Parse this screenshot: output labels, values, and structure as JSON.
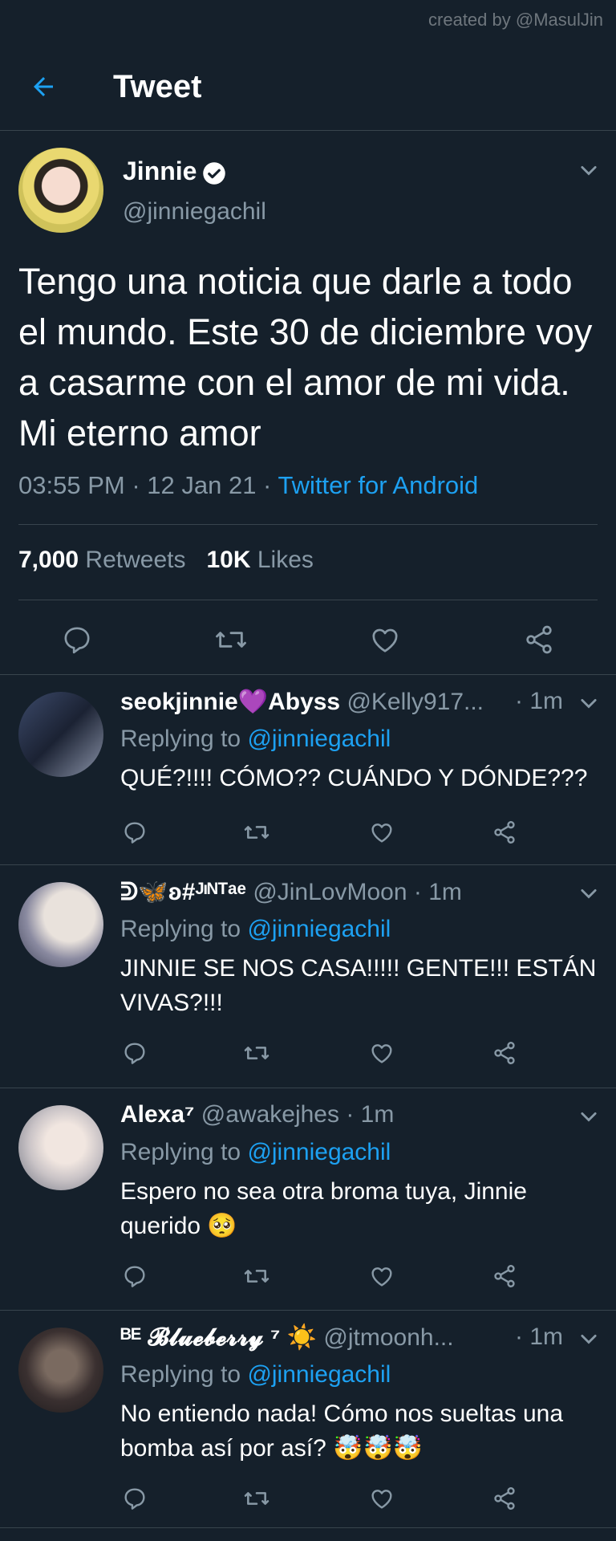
{
  "credit": "created by @MasulJin",
  "header": {
    "title": "Tweet",
    "back_icon": "arrow-left-icon"
  },
  "tweet": {
    "name": "Jinnie",
    "handle": "@jinniegachil",
    "text": "Tengo una noticia que darle a todo el mundo. Este 30 de diciembre voy a casarme con el amor de mi vida. Mi eterno amor",
    "time": "03:55 PM",
    "date": "12 Jan 21",
    "separator": " · ",
    "source": "Twitter for Android",
    "retweets_count": "7,000",
    "retweets_label": "Retweets",
    "likes_count": "10K",
    "likes_label": "Likes"
  },
  "replies": [
    {
      "name": "seokjinnie💜Abyss",
      "handle": "@Kelly917...",
      "time": "· 1m",
      "replying_prefix": "Replying to ",
      "replying_to": "@jinniegachil",
      "text": "QUÉ?!!!! CÓMO?? CUÁNDO Y DÓNDE???"
    },
    {
      "name": "ᕲ🦋ʚ#ᴶᶦᴺᵀᵃᵉ",
      "handle": "@JinLovMoon",
      "time": "· 1m",
      "replying_prefix": "Replying to ",
      "replying_to": "@jinniegachil",
      "text": "JINNIE SE NOS CASA!!!!! GENTE!!! ESTÁN VIVAS?!!!"
    },
    {
      "name": "Alexa⁷",
      "handle": "@awakejhes",
      "time": "· 1m",
      "replying_prefix": "Replying to ",
      "replying_to": "@jinniegachil",
      "text": "Espero no sea otra broma tuya, Jinnie querido 🥺"
    },
    {
      "name": "ᴮᴱ 𝓑𝓵𝓾𝓮𝓫𝓮𝓻𝓻𝔂 ⁷ ☀️",
      "handle": "@jtmoonh...",
      "time": "· 1m",
      "replying_prefix": "Replying to ",
      "replying_to": "@jinniegachil",
      "text": "No entiendo nada! Cómo nos sueltas una bomba así por así? 🤯🤯🤯"
    }
  ],
  "colors": {
    "background": "#15202b",
    "accent": "#1da1f2",
    "muted": "#8899a6",
    "divider": "#38444d"
  }
}
